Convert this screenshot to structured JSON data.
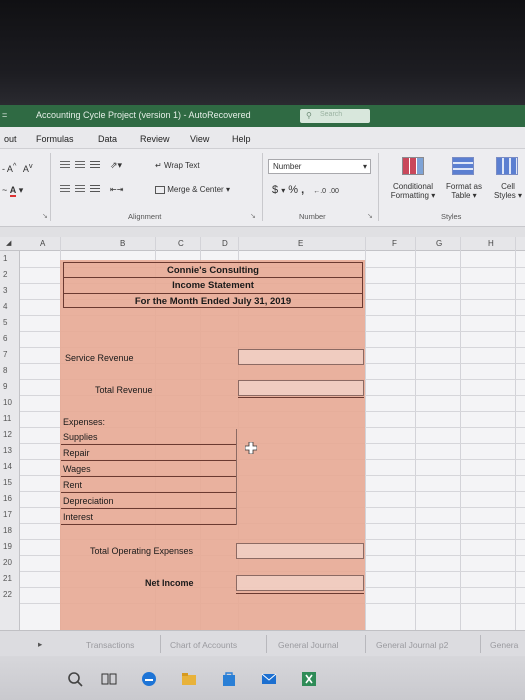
{
  "window": {
    "title": "Accounting Cycle Project (version 1)  -  AutoRecovered",
    "search_placeholder": "Search"
  },
  "ribbon_tabs": [
    "out",
    "Formulas",
    "Data",
    "Review",
    "View",
    "Help"
  ],
  "ribbon": {
    "wrap_text": "Wrap Text",
    "merge_center": "Merge & Center",
    "number_format": "Number",
    "currency_symbol": "$",
    "percent_symbol": "%",
    "comma_symbol": ",",
    "conditional_formatting_line1": "Conditional",
    "conditional_formatting_line2": "Formatting",
    "format_as_table_line1": "Format as",
    "format_as_table_line2": "Table",
    "cell_styles_line1": "Cell",
    "cell_styles_line2": "Styles",
    "group_alignment": "Alignment",
    "group_number": "Number",
    "group_styles": "Styles",
    "font_grow": "A",
    "font_shrink": "A"
  },
  "columns": [
    "A",
    "B",
    "C",
    "D",
    "E",
    "F",
    "G",
    "H"
  ],
  "rows": [
    "1",
    "2",
    "3",
    "4",
    "5",
    "6",
    "7",
    "8",
    "9",
    "10",
    "11",
    "12",
    "13",
    "14",
    "15",
    "16",
    "17",
    "18",
    "19",
    "20",
    "21",
    "22"
  ],
  "statement": {
    "company": "Connie's Consulting",
    "title": "Income Statement",
    "period": "For the Month Ended July 31, 2019",
    "service_revenue": "Service Revenue",
    "total_revenue": "Total Revenue",
    "expenses_label": "Expenses:",
    "expenses": [
      "Supplies",
      "Repair",
      "Wages",
      "Rent",
      "Depreciation",
      "Interest"
    ],
    "total_operating_expenses": "Total Operating Expenses",
    "net_income": "Net Income"
  },
  "sheet_tabs": [
    "Transactions",
    "Chart of Accounts",
    "General Journal",
    "General Journal p2",
    "Genera"
  ],
  "colors": {
    "title_bar": "#2f6a43",
    "statement_fill": "#e7aa96"
  }
}
